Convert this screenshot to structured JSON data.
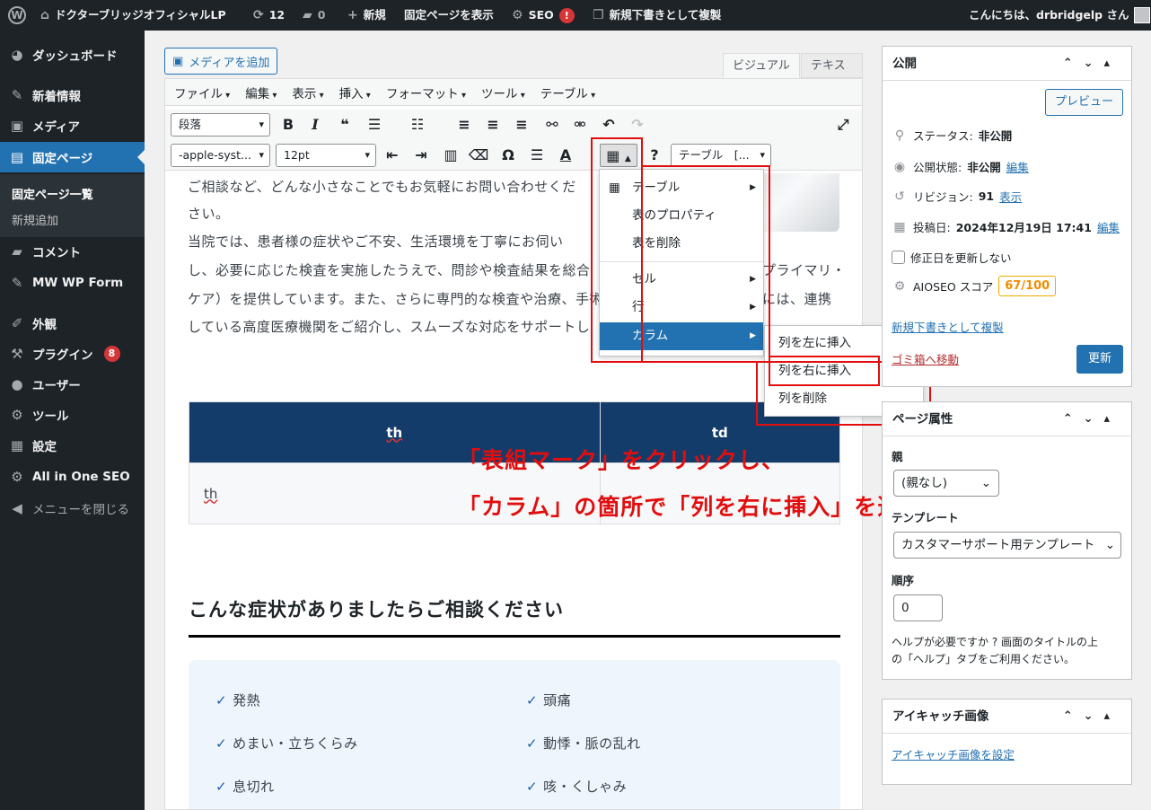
{
  "admin_bar": {
    "site_name": "ドクターブリッジオフィシャルLP",
    "updates_count": "12",
    "comments_count": "0",
    "new_label": "新規",
    "view_page": "固定ページを表示",
    "seo_label": "SEO",
    "seo_badge": "!",
    "duplicate_draft": "新規下書きとして複製",
    "greeting": "こんにちは、drbridgelp さん"
  },
  "sidebar": {
    "items": [
      {
        "label": "ダッシュボード",
        "icon": "dashboard-icon"
      },
      {
        "label": "新着情報",
        "icon": "pin-icon"
      },
      {
        "label": "メディア",
        "icon": "media-icon"
      },
      {
        "label": "固定ページ",
        "icon": "page-icon"
      },
      {
        "label": "コメント",
        "icon": "comment-icon"
      },
      {
        "label": "MW WP Form",
        "icon": "pin-icon"
      },
      {
        "label": "外観",
        "icon": "brush-icon"
      },
      {
        "label": "プラグイン",
        "icon": "plugin-icon",
        "badge": "8"
      },
      {
        "label": "ユーザー",
        "icon": "user-icon"
      },
      {
        "label": "ツール",
        "icon": "wrench-icon"
      },
      {
        "label": "設定",
        "icon": "settings-icon"
      },
      {
        "label": "All in One SEO",
        "icon": "aioseo-icon"
      },
      {
        "label": "メニューを閉じる",
        "icon": "collapse-icon"
      }
    ],
    "submenu": [
      "固定ページ一覧",
      "新規追加"
    ]
  },
  "editor": {
    "add_media": "メディアを追加",
    "tab_visual": "ビジュアル",
    "tab_text": "テキスト",
    "menubar": [
      "ファイル",
      "編集",
      "表示",
      "挿入",
      "フォーマット",
      "ツール",
      "テーブル"
    ],
    "format_select": "段落",
    "font_select": "-apple-syst...",
    "size_select": "12pt",
    "table_select": "テーブル　[..."
  },
  "content": {
    "lines": [
      "ご相談など、どんな小さなことでもお気軽にお問い合わせくだ",
      "さい。",
      "当院では、患者様の症状やご不安、生活環境を丁寧にお伺い",
      "し、必要に応じた検査を実施したうえで、問診や検査結果を総合",
      "ケア）を提供しています。また、さらに専門的な検査や治療、手術",
      "している高度医療機関をご紹介し、スムーズな対応をサポートし"
    ],
    "line_tail_3": "プライマリ・",
    "line_tail_4": "には、連携",
    "table": {
      "h1": "th",
      "h2": "td",
      "b1": "th"
    },
    "heading": "こんな症状がありましたらご相談ください",
    "symptoms": [
      "発熱",
      "頭痛",
      "めまい・立ちくらみ",
      "動悸・脈の乱れ",
      "息切れ",
      "咳・くしゃみ"
    ]
  },
  "table_menu": {
    "items": [
      "テーブル",
      "表のプロパティ",
      "表を削除",
      "セル",
      "行",
      "カラム"
    ],
    "submenu": [
      "列を左に挿入",
      "列を右に挿入",
      "列を削除"
    ]
  },
  "annotation": {
    "line1": "「表組マーク」をクリックし、",
    "line2": "「カラム」の箇所で「列を右に挿入」を選択"
  },
  "publish": {
    "title": "公開",
    "preview": "プレビュー",
    "status_label": "ステータス:",
    "status_value": "非公開",
    "visibility_label": "公開状態:",
    "visibility_value": "非公開",
    "edit": "編集",
    "revision_label": "リビジョン:",
    "revision_value": "91",
    "show": "表示",
    "date_label": "投稿日:",
    "date_value": "2024年12月19日 17:41",
    "no_update_date": "修正日を更新しない",
    "aioseo_label": "AIOSEO スコア",
    "aioseo_score": "67/100",
    "copy_link": "新規下書きとして複製",
    "trash": "ゴミ箱へ移動",
    "update": "更新"
  },
  "attributes": {
    "title": "ページ属性",
    "parent_label": "親",
    "parent_value": "(親なし)",
    "template_label": "テンプレート",
    "template_value": "カスタマーサポート用テンプレート",
    "order_label": "順序",
    "order_value": "0",
    "help": [
      "ヘルプが必要ですか ? 画面のタイトルの上",
      "の「ヘルプ」タブをご利用ください。"
    ]
  },
  "featured": {
    "title": "アイキャッチ画像",
    "set_link": "アイキャッチ画像を設定"
  },
  "colors": {
    "accent": "#2271b1",
    "admin_bg": "#1d2327",
    "annotation": "#e20e0e",
    "table_head": "#133c6b"
  }
}
